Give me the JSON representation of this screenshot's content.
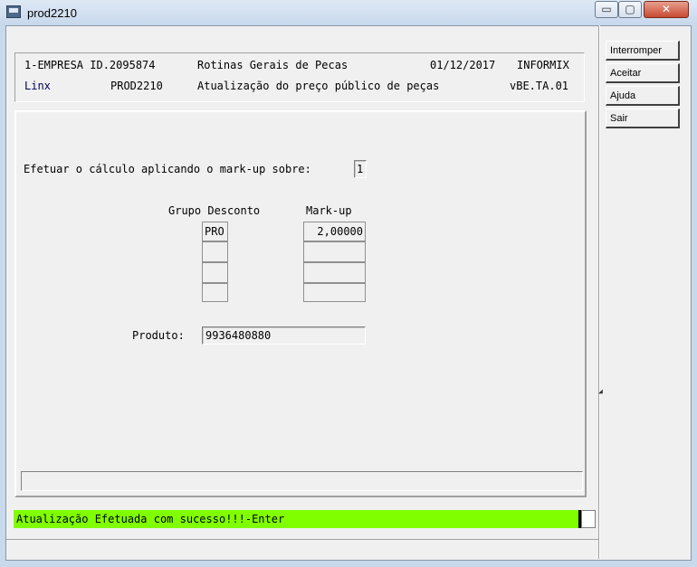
{
  "window": {
    "title": "prod2210",
    "min_glyph": "▭",
    "max_glyph": "▢",
    "close_glyph": "✕"
  },
  "sidebar": {
    "buttons": [
      {
        "label": "Interromper"
      },
      {
        "label": "Aceitar"
      },
      {
        "label": "Ajuda"
      },
      {
        "label": "Sair"
      }
    ]
  },
  "header": {
    "line1": {
      "company": "1-EMPRESA ID.2095874",
      "module": "Rotinas Gerais de Pecas",
      "date": "01/12/2017",
      "db": "INFORMIX"
    },
    "line2": {
      "brand": "Linx",
      "program": "PROD2210",
      "description": "Atualização do preço público de peças",
      "version": "vBE.TA.01"
    }
  },
  "form": {
    "markup_prompt": "Efetuar o cálculo aplicando o mark-up sobre:",
    "markup_option": "1",
    "col_group": "Grupo Desconto",
    "col_markup": "Mark-up",
    "rows": [
      {
        "group": "PRO",
        "markup": "2,00000"
      },
      {
        "group": "",
        "markup": ""
      },
      {
        "group": "",
        "markup": ""
      },
      {
        "group": "",
        "markup": ""
      }
    ],
    "produto_label": "Produto:",
    "produto_value": "9936480880"
  },
  "status": {
    "message": "Atualização Efetuada com sucesso!!!-Enter",
    "highlight_color": "#80ff00"
  }
}
